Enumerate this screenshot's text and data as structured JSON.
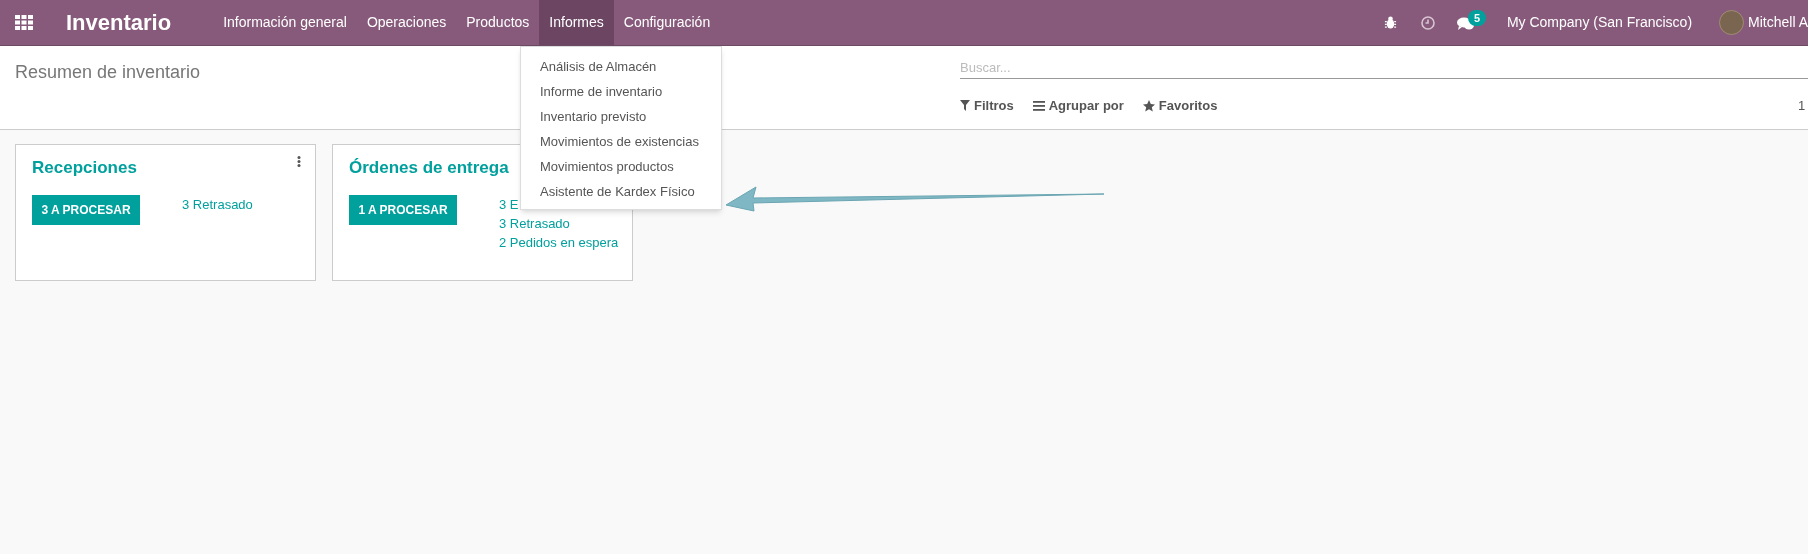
{
  "navbar": {
    "app_title": "Inventario",
    "menu": [
      {
        "label": "Información general",
        "selected": false
      },
      {
        "label": "Operaciones",
        "selected": false
      },
      {
        "label": "Productos",
        "selected": false
      },
      {
        "label": "Informes",
        "selected": true
      },
      {
        "label": "Configuración",
        "selected": false
      }
    ],
    "messages_badge": "5",
    "company": "My Company (San Francisco)",
    "user": "Mitchell A"
  },
  "dropdown": {
    "items": [
      "Análisis de Almacén",
      "Informe de inventario",
      "Inventario previsto",
      "Movimientos de existencias",
      "Movimientos productos",
      "Asistente de Kardex Físico"
    ]
  },
  "control_panel": {
    "breadcrumb": "Resumen de inventario",
    "search": {
      "placeholder": "Buscar..."
    },
    "filters": [
      {
        "kind": "filter",
        "label": "Filtros"
      },
      {
        "kind": "group",
        "label": "Agrupar por"
      },
      {
        "kind": "favorite",
        "label": "Favoritos"
      }
    ],
    "pager": "1"
  },
  "cards": [
    {
      "title": "Recepciones",
      "button": "3 A PROCESAR",
      "links": [
        "3 Retrasado"
      ],
      "menu": true
    },
    {
      "title": "Órdenes de entrega",
      "button": "1 A PROCESAR",
      "links": [
        "3 E",
        "3 Retrasado",
        "2 Pedidos en espera"
      ],
      "menu": false
    }
  ]
}
